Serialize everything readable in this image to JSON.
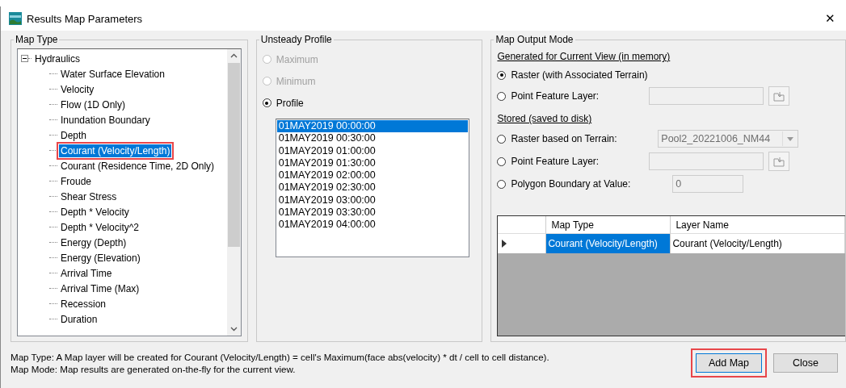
{
  "window": {
    "title": "Results Map Parameters",
    "close": "✕"
  },
  "map_type": {
    "title": "Map Type",
    "tree": [
      {
        "label": "Hydraulics",
        "expanded": true,
        "selected": false,
        "children": [
          {
            "label": "Water Surface Elevation",
            "selected": false
          },
          {
            "label": "Velocity",
            "selected": false
          },
          {
            "label": "Flow (1D Only)",
            "selected": false
          },
          {
            "label": "Inundation Boundary",
            "selected": false
          },
          {
            "label": "Depth",
            "selected": false
          },
          {
            "label": "Courant (Velocity/Length)",
            "selected": true,
            "highlighted": true
          },
          {
            "label": "Courant (Residence Time, 2D Only)",
            "selected": false
          },
          {
            "label": "Froude",
            "selected": false
          },
          {
            "label": "Shear Stress",
            "selected": false
          },
          {
            "label": "Depth * Velocity",
            "selected": false
          },
          {
            "label": "Depth * Velocity^2",
            "selected": false
          },
          {
            "label": "Energy (Depth)",
            "selected": false
          },
          {
            "label": "Energy (Elevation)",
            "selected": false
          },
          {
            "label": "Arrival Time",
            "selected": false
          },
          {
            "label": "Arrival Time (Max)",
            "selected": false
          },
          {
            "label": "Recession",
            "selected": false
          },
          {
            "label": "Duration",
            "selected": false
          }
        ]
      }
    ]
  },
  "unsteady_profile": {
    "title": "Unsteady Profile",
    "options": [
      {
        "label": "Maximum",
        "selected": false,
        "disabled": true
      },
      {
        "label": "Minimum",
        "selected": false,
        "disabled": true
      },
      {
        "label": "Profile",
        "selected": true,
        "disabled": false
      }
    ],
    "profiles": [
      {
        "label": "01MAY2019 00:00:00",
        "selected": true
      },
      {
        "label": "01MAY2019 00:30:00",
        "selected": false
      },
      {
        "label": "01MAY2019 01:00:00",
        "selected": false
      },
      {
        "label": "01MAY2019 01:30:00",
        "selected": false
      },
      {
        "label": "01MAY2019 02:00:00",
        "selected": false
      },
      {
        "label": "01MAY2019 02:30:00",
        "selected": false
      },
      {
        "label": "01MAY2019 03:00:00",
        "selected": false
      },
      {
        "label": "01MAY2019 03:30:00",
        "selected": false
      },
      {
        "label": "01MAY2019 04:00:00",
        "selected": false
      }
    ]
  },
  "map_output_mode": {
    "title": "Map Output Mode",
    "rows": [
      {
        "kind": "heading",
        "label": "Generated for Current View (in memory)"
      },
      {
        "kind": "radio",
        "label": "Raster (with Associated Terrain)",
        "selected": true
      },
      {
        "kind": "radio-file",
        "label": "Point Feature Layer:",
        "selected": false
      },
      {
        "kind": "heading",
        "label": "Stored (saved to disk)"
      },
      {
        "kind": "radio-select",
        "label": "Raster based on Terrain:",
        "selected": false,
        "value": "Pool2_20221006_NM44"
      },
      {
        "kind": "radio-file",
        "label": "Point Feature Layer:",
        "selected": false
      },
      {
        "kind": "radio-value",
        "label": "Polygon Boundary at Value:",
        "selected": false,
        "value": "0"
      }
    ],
    "table": {
      "columns": [
        "Map Type",
        "Layer Name"
      ],
      "rows": [
        {
          "current": true,
          "cells": [
            "Courant (Velocity/Length)",
            "Courant (Velocity/Length)"
          ]
        }
      ]
    }
  },
  "status": [
    "Map Type: A Map layer will be created for Courant (Velocity/Length) = cell's Maximum(face abs(velocity) * dt / cell to cell distance).",
    "Map Mode: Map results are generated on-the-fly for the current view."
  ],
  "buttons": [
    {
      "label": "Add Map",
      "highlighted": true
    },
    {
      "label": "Close"
    }
  ]
}
